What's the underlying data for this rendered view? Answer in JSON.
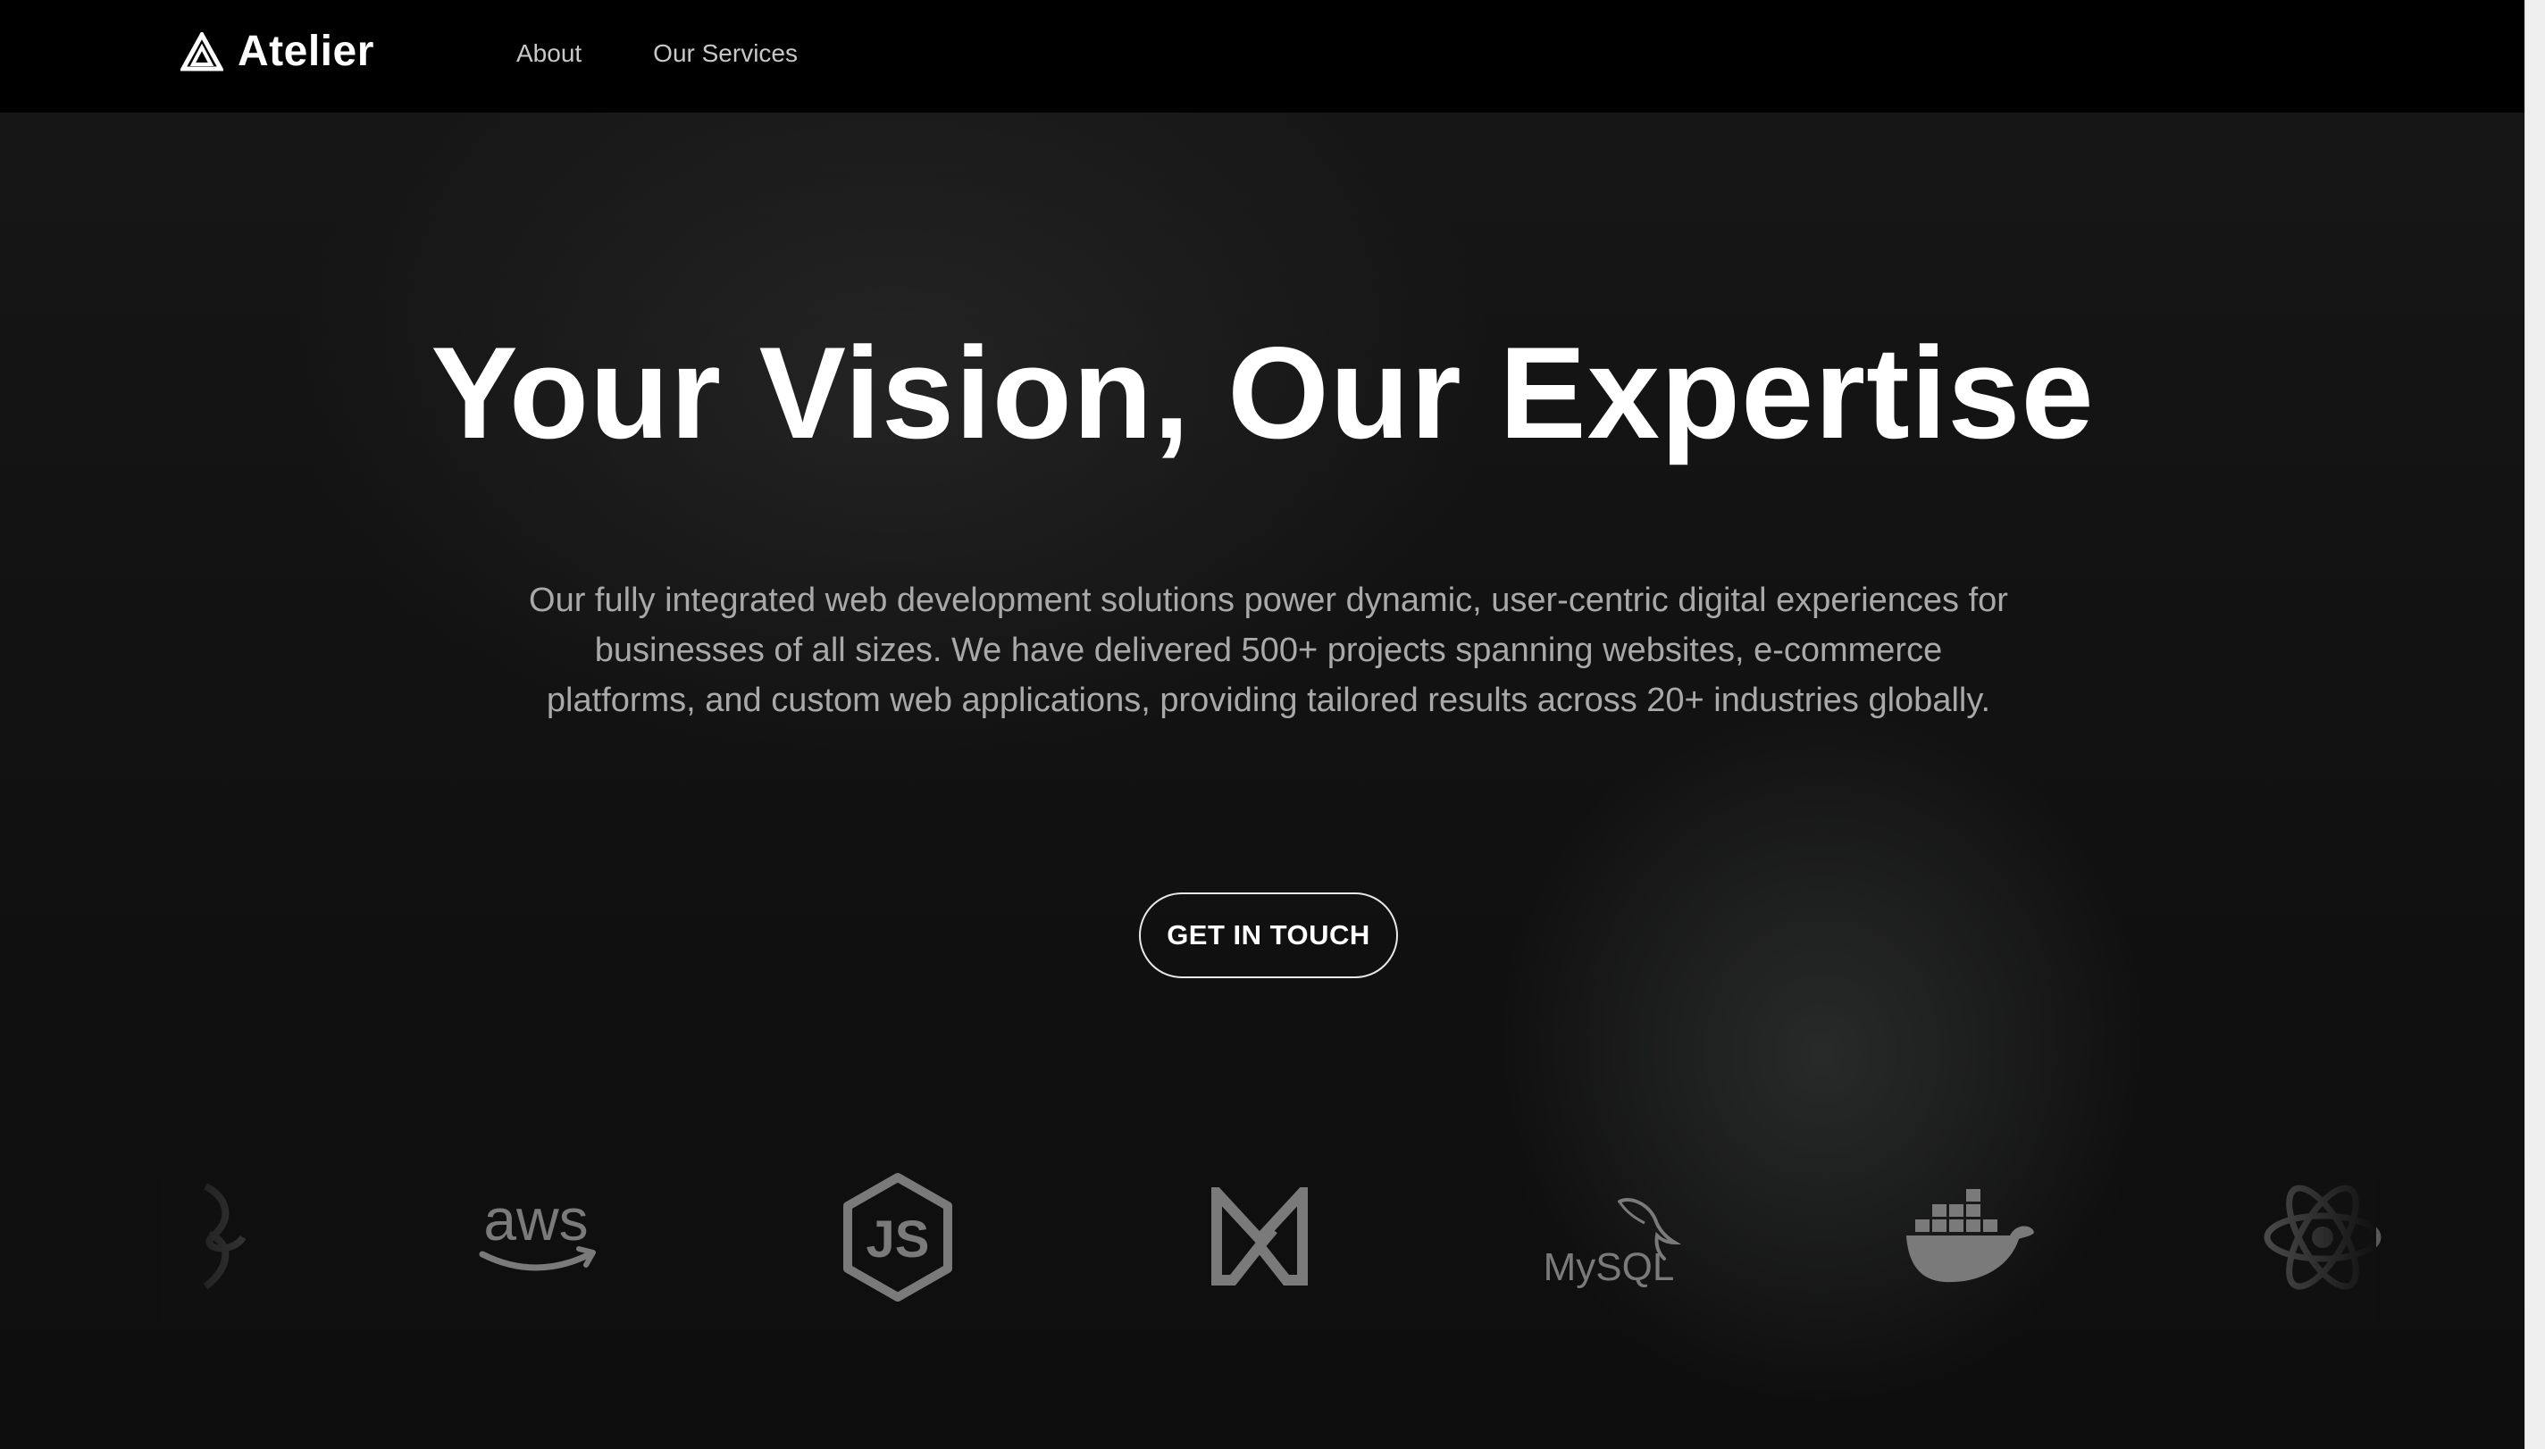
{
  "header": {
    "brand": "Atelier",
    "logo_icon": "triangle-a-icon",
    "nav": [
      {
        "label": "About"
      },
      {
        "label": "Our Services"
      }
    ]
  },
  "hero": {
    "title": "Your Vision, Our Expertise",
    "description": "Our fully integrated web development solutions power dynamic, user-centric digital experiences for businesses of all sizes. We have delivered 500+ projects spanning websites, e-commerce platforms, and custom web applications, providing tailored results across 20+ industries globally.",
    "cta_label": "GET IN TOUCH"
  },
  "tech_logos": {
    "items": [
      {
        "icon": "partial-logo-icon"
      },
      {
        "icon": "aws-logo-icon",
        "text": "aws"
      },
      {
        "icon": "nodejs-logo-icon",
        "text": "JS"
      },
      {
        "icon": "mui-logo-icon"
      },
      {
        "icon": "mysql-logo-icon",
        "text": "MySQL"
      },
      {
        "icon": "docker-logo-icon"
      },
      {
        "icon": "react-logo-icon"
      }
    ]
  },
  "colors": {
    "background": "#121212",
    "header": "#000000",
    "text": "#ffffff",
    "muted_text": "#a9a9a9",
    "logo_gray": "#7a7a7a"
  }
}
